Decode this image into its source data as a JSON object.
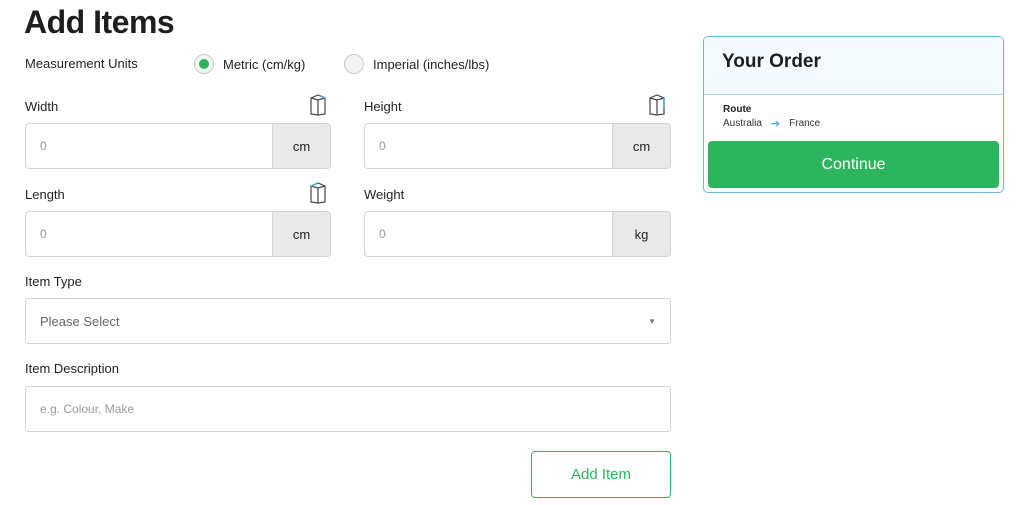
{
  "page": {
    "title": "Add Items"
  },
  "units": {
    "label": "Measurement Units",
    "options": [
      {
        "label": "Metric (cm/kg)",
        "selected": true
      },
      {
        "label": "Imperial (inches/lbs)",
        "selected": false
      }
    ]
  },
  "fields": {
    "width": {
      "label": "Width",
      "placeholder": "0",
      "unit": "cm",
      "icon": "box-icon"
    },
    "height": {
      "label": "Height",
      "placeholder": "0",
      "unit": "cm",
      "icon": "box-icon"
    },
    "length": {
      "label": "Length",
      "placeholder": "0",
      "unit": "cm",
      "icon": "box-icon"
    },
    "weight": {
      "label": "Weight",
      "placeholder": "0",
      "unit": "kg"
    },
    "item_type": {
      "label": "Item Type",
      "selected": "Please Select"
    },
    "item_description": {
      "label": "Item Description",
      "placeholder": "e.g. Colour, Make"
    }
  },
  "actions": {
    "add_item_label": "Add Item"
  },
  "order": {
    "title": "Your Order",
    "route_label": "Route",
    "origin": "Australia",
    "destination": "France",
    "continue_label": "Continue"
  },
  "colors": {
    "accent_green": "#2db55d",
    "card_border": "#6ab8e3",
    "route_arrow": "#4aa7de"
  }
}
